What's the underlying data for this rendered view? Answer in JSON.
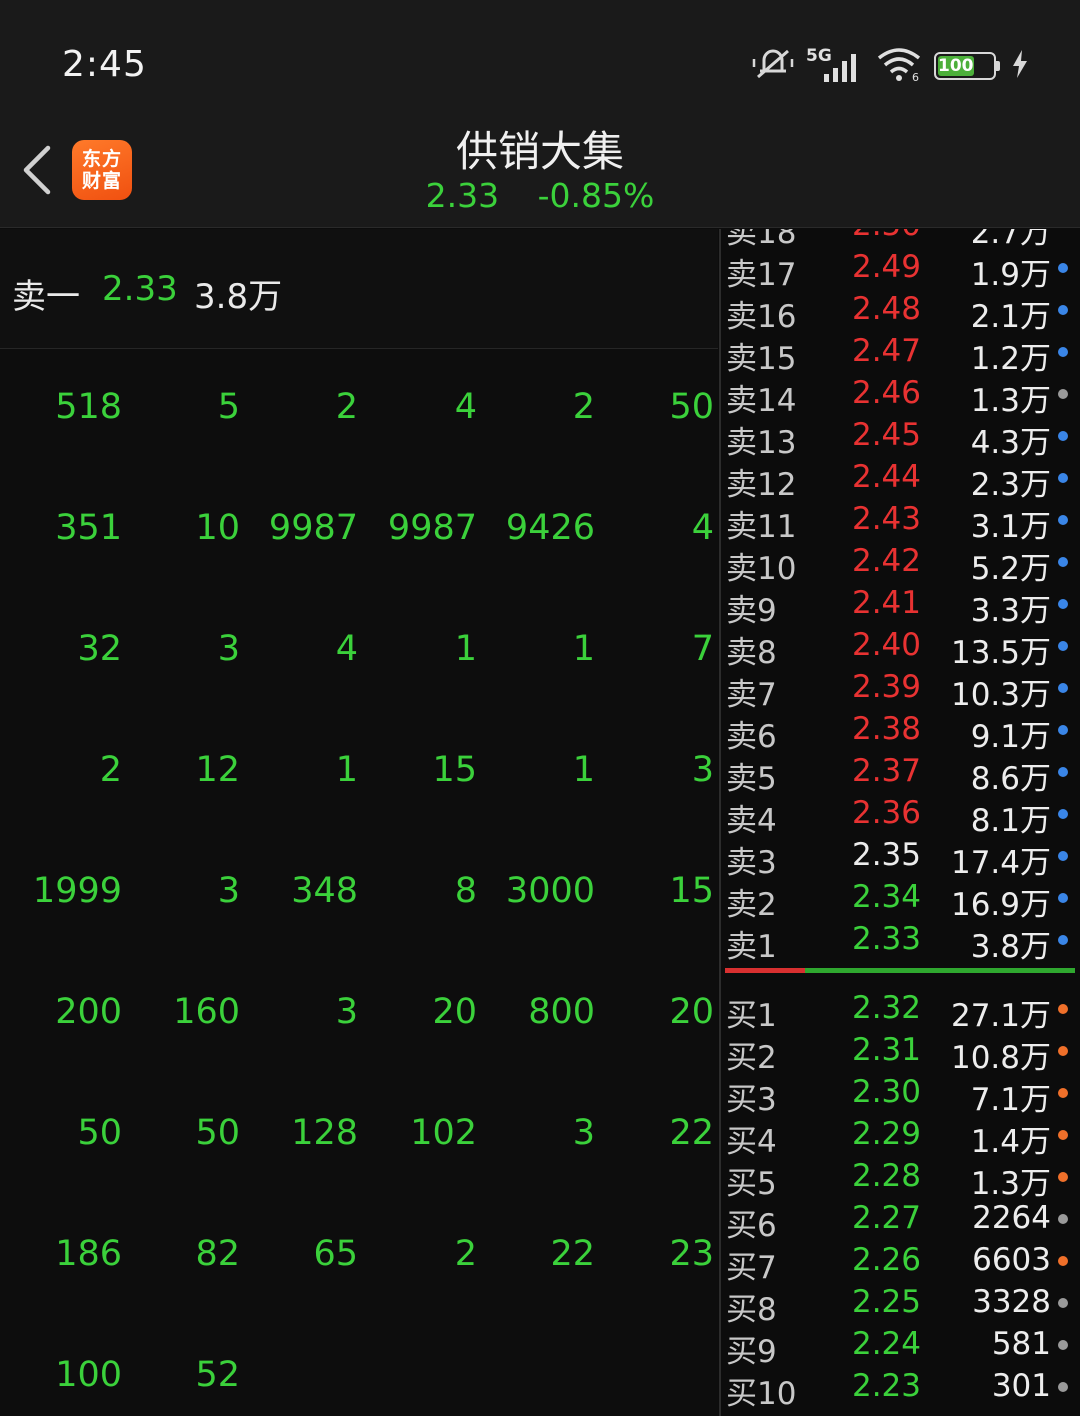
{
  "status_bar": {
    "time": "2:45",
    "network": "5G",
    "battery": "100"
  },
  "header": {
    "logo_line1": "东方",
    "logo_line2": "财富",
    "title": "供销大集",
    "price": "2.33",
    "change_pct": "-0.85%"
  },
  "best_ask": {
    "label": "卖一",
    "price": "2.33",
    "volume": "3.8万"
  },
  "queue_rows": [
    [
      "518",
      "5",
      "2",
      "4",
      "2",
      "50"
    ],
    [
      "351",
      "10",
      "9987",
      "9987",
      "9426",
      "4"
    ],
    [
      "32",
      "3",
      "4",
      "1",
      "1",
      "7"
    ],
    [
      "2",
      "12",
      "1",
      "15",
      "1",
      "3"
    ],
    [
      "1999",
      "3",
      "348",
      "8",
      "3000",
      "15"
    ],
    [
      "200",
      "160",
      "3",
      "20",
      "800",
      "20"
    ],
    [
      "50",
      "50",
      "128",
      "102",
      "3",
      "22"
    ],
    [
      "186",
      "82",
      "65",
      "2",
      "22",
      "23"
    ],
    [
      "100",
      "52",
      "",
      "",
      "",
      ""
    ]
  ],
  "sell_orders": [
    {
      "label": "卖17",
      "price": "2.49",
      "volume": "1.9万",
      "price_color": "red",
      "dot": "#3a86e8"
    },
    {
      "label": "卖16",
      "price": "2.48",
      "volume": "2.1万",
      "price_color": "red",
      "dot": "#3a86e8"
    },
    {
      "label": "卖15",
      "price": "2.47",
      "volume": "1.2万",
      "price_color": "red",
      "dot": "#3a86e8"
    },
    {
      "label": "卖14",
      "price": "2.46",
      "volume": "1.3万",
      "price_color": "red",
      "dot": "#9a9a9a"
    },
    {
      "label": "卖13",
      "price": "2.45",
      "volume": "4.3万",
      "price_color": "red",
      "dot": "#3a86e8"
    },
    {
      "label": "卖12",
      "price": "2.44",
      "volume": "2.3万",
      "price_color": "red",
      "dot": "#3a86e8"
    },
    {
      "label": "卖11",
      "price": "2.43",
      "volume": "3.1万",
      "price_color": "red",
      "dot": "#3a86e8"
    },
    {
      "label": "卖10",
      "price": "2.42",
      "volume": "5.2万",
      "price_color": "red",
      "dot": "#3a86e8"
    },
    {
      "label": "卖9",
      "price": "2.41",
      "volume": "3.3万",
      "price_color": "red",
      "dot": "#3a86e8"
    },
    {
      "label": "卖8",
      "price": "2.40",
      "volume": "13.5万",
      "price_color": "red",
      "dot": "#3a86e8"
    },
    {
      "label": "卖7",
      "price": "2.39",
      "volume": "10.3万",
      "price_color": "red",
      "dot": "#3a86e8"
    },
    {
      "label": "卖6",
      "price": "2.38",
      "volume": "9.1万",
      "price_color": "red",
      "dot": "#3a86e8"
    },
    {
      "label": "卖5",
      "price": "2.37",
      "volume": "8.6万",
      "price_color": "red",
      "dot": "#3a86e8"
    },
    {
      "label": "卖4",
      "price": "2.36",
      "volume": "8.1万",
      "price_color": "red",
      "dot": "#3a86e8"
    },
    {
      "label": "卖3",
      "price": "2.35",
      "volume": "17.4万",
      "price_color": "white",
      "dot": "#3a86e8"
    },
    {
      "label": "卖2",
      "price": "2.34",
      "volume": "16.9万",
      "price_color": "green",
      "dot": "#3a86e8"
    },
    {
      "label": "卖1",
      "price": "2.33",
      "volume": "3.8万",
      "price_color": "green",
      "dot": "#3a86e8"
    }
  ],
  "buy_orders": [
    {
      "label": "买1",
      "price": "2.32",
      "volume": "27.1万",
      "price_color": "green",
      "dot": "#f0702a"
    },
    {
      "label": "买2",
      "price": "2.31",
      "volume": "10.8万",
      "price_color": "green",
      "dot": "#f0702a"
    },
    {
      "label": "买3",
      "price": "2.30",
      "volume": "7.1万",
      "price_color": "green",
      "dot": "#f0702a"
    },
    {
      "label": "买4",
      "price": "2.29",
      "volume": "1.4万",
      "price_color": "green",
      "dot": "#f0702a"
    },
    {
      "label": "买5",
      "price": "2.28",
      "volume": "1.3万",
      "price_color": "green",
      "dot": "#f0702a"
    },
    {
      "label": "买6",
      "price": "2.27",
      "volume": "2264",
      "price_color": "green",
      "dot": "#9a9a9a"
    },
    {
      "label": "买7",
      "price": "2.26",
      "volume": "6603",
      "price_color": "green",
      "dot": "#f0702a"
    },
    {
      "label": "买8",
      "price": "2.25",
      "volume": "3328",
      "price_color": "green",
      "dot": "#9a9a9a"
    },
    {
      "label": "买9",
      "price": "2.24",
      "volume": "581",
      "price_color": "green",
      "dot": "#9a9a9a"
    },
    {
      "label": "买10",
      "price": "2.23",
      "volume": "301",
      "price_color": "green",
      "dot": "#9a9a9a"
    }
  ]
}
